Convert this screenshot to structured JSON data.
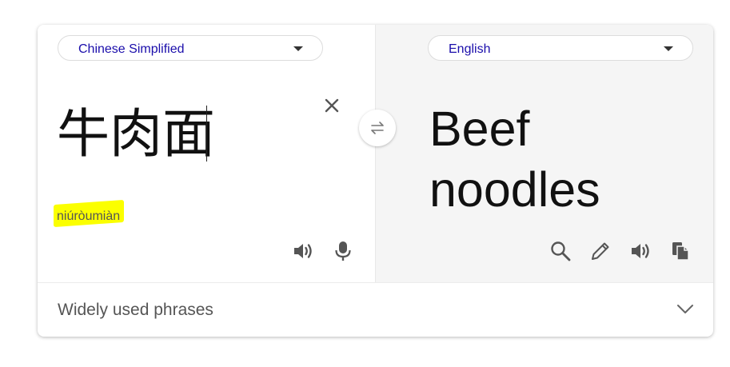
{
  "source": {
    "language": "Chinese Simplified",
    "text": "牛肉面",
    "romanization": "niúròumiàn"
  },
  "target": {
    "language": "English",
    "text_line1": "Beef",
    "text_line2": "noodles"
  },
  "phrases": {
    "label": "Widely used phrases"
  },
  "colors": {
    "accent_link": "#1a0dab",
    "highlight": "#fbff00",
    "target_bg": "#f5f5f5",
    "icon": "#555555"
  },
  "icons": {
    "clear": "close-icon",
    "swap": "swap-icon",
    "source_listen": "speaker-icon",
    "mic": "microphone-icon",
    "search": "search-icon",
    "edit": "pencil-icon",
    "target_listen": "speaker-icon",
    "copy": "copy-icon",
    "expand": "chevron-down-icon",
    "dropdown": "caret-down-icon"
  }
}
